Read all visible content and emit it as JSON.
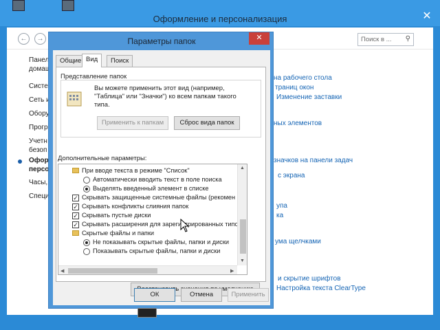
{
  "window": {
    "title": "Оформление и персонализация",
    "close_glyph": "✕",
    "search_placeholder": "Поиск в ...",
    "sidebar": [
      "Панел",
      "домаш",
      "Систе",
      "Сеть и",
      "Обору",
      "Прогр",
      "Учетн",
      "безоп",
      "Офор",
      "персо",
      "Часы,",
      "Специ"
    ],
    "links": [
      "на рабочего стола",
      "траниц окон",
      "Изменение заставки",
      "ных элементов",
      "значков на панели задач",
      "с экрана",
      "упа",
      "ка",
      "ума щелчками",
      "и скрытие шрифтов",
      "Настройка текста ClearType"
    ]
  },
  "dialog": {
    "title": "Параметры папок",
    "close_glyph": "✕",
    "tabs": [
      "Общие",
      "Вид",
      "Поиск"
    ],
    "folder_view": {
      "title": "Представление папок",
      "description": "Вы можете применить этот вид (например, \"Таблица\" или \"Значки\") ко всем папкам такого типа.",
      "apply_button": "Применить к папкам",
      "reset_button": "Сброс вида папок"
    },
    "advanced": {
      "title": "Дополнительные параметры:",
      "items": [
        {
          "kind": "folder",
          "label": "При вводе текста в режиме \"Список\""
        },
        {
          "kind": "radio",
          "checked": false,
          "label": "Автоматически вводить текст в поле поиска"
        },
        {
          "kind": "radio",
          "checked": true,
          "label": "Выделять введенный элемент в списке"
        },
        {
          "kind": "check",
          "checked": true,
          "label": "Скрывать защищенные системные файлы (рекомен"
        },
        {
          "kind": "check",
          "checked": true,
          "label": "Скрывать конфликты слияния папок"
        },
        {
          "kind": "check",
          "checked": true,
          "label": "Скрывать пустые диски"
        },
        {
          "kind": "check",
          "checked": true,
          "label": "Скрывать расширения для зарегистрированных типо"
        },
        {
          "kind": "folder",
          "label": "Скрытые файлы и папки"
        },
        {
          "kind": "radio",
          "checked": true,
          "label": "Не показывать скрытые файлы, папки и диски"
        },
        {
          "kind": "radio",
          "checked": false,
          "label": "Показывать скрытые файлы, папки и диски"
        }
      ]
    },
    "restore_button": "Восстановить значения по умолчанию",
    "ok_button": "ОК",
    "cancel_button": "Отмена",
    "apply_button": "Применить"
  }
}
